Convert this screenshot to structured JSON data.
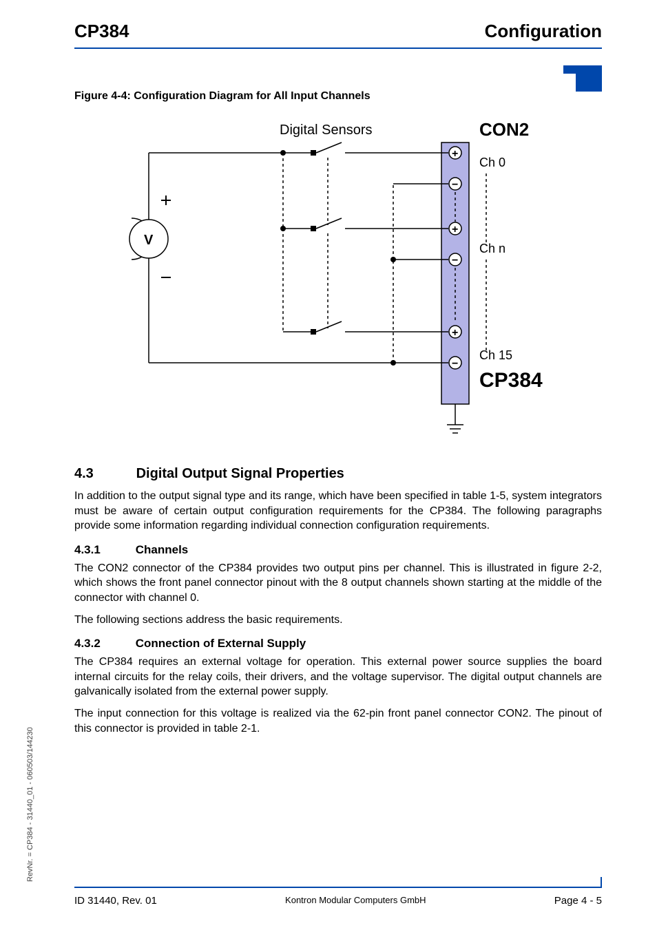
{
  "header": {
    "left": "CP384",
    "right": "Configuration"
  },
  "figure": {
    "title": "Figure 4-4:  Configuration Diagram for All Input Channels",
    "digital_sensors": "Digital Sensors",
    "con2": "CON2",
    "ch0": "Ch 0",
    "chn": "Ch n",
    "ch15": "Ch 15",
    "cp384": "CP384",
    "v": "V"
  },
  "section43": {
    "num": "4.3",
    "title": "Digital Output Signal Properties",
    "p1": "In addition to the output signal type and its range, which have been specified in table 1-5, system integrators must be aware of certain output configuration requirements for the CP384. The following paragraphs provide some information regarding individual connection configuration requirements."
  },
  "section431": {
    "num": "4.3.1",
    "title": "Channels",
    "p1": "The CON2 connector of the CP384 provides two output pins per channel. This is illustrated in figure 2-2, which shows the front panel connector pinout with the 8 output channels shown starting at the middle of the connector with channel 0.",
    "p2": "The following sections address the basic requirements."
  },
  "section432": {
    "num": "4.3.2",
    "title": "Connection of External Supply",
    "p1": "The CP384 requires an external voltage for operation. This external power source supplies the board internal circuits for the relay coils, their drivers, and the voltage supervisor. The digital output channels are galvanically isolated from the external power supply.",
    "p2": "The input connection for this voltage is realized via the 62-pin front panel connector CON2. The pinout of this connector is provided in table 2-1."
  },
  "side": "RevNr. = CP384 - 31440_01 - 060503/144230",
  "footer": {
    "left": "ID 31440, Rev. 01",
    "center": "Kontron Modular Computers GmbH",
    "right": "Page 4 - 5"
  }
}
